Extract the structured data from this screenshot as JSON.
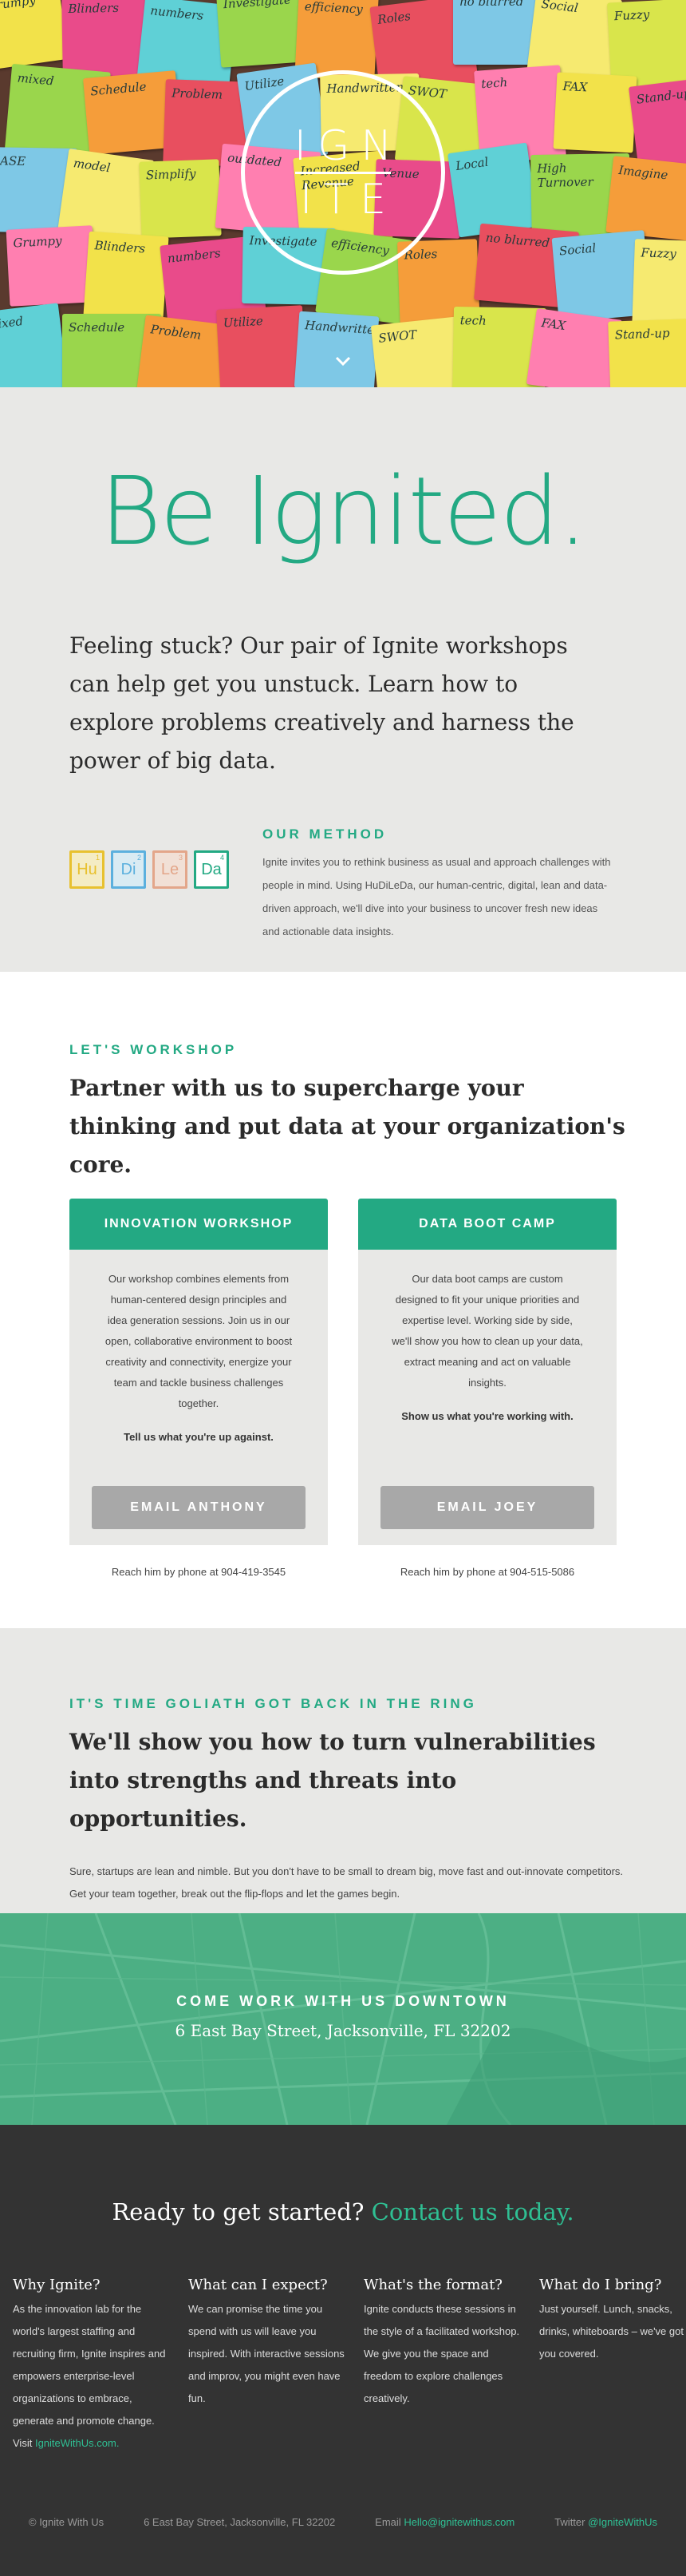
{
  "hero": {
    "logo_top": "IGN",
    "logo_bottom": "ITE",
    "notes": [
      "Grumpy",
      "Blinders",
      "numbers",
      "Investigate",
      "efficiency",
      "Roles",
      "no blurred",
      "Social",
      "Fuzzy",
      "mixed",
      "Schedule",
      "Problem",
      "Utilize",
      "Handwritten",
      "SWOT",
      "tech",
      "FAX",
      "Stand-up",
      "CASE",
      "model",
      "Simplify",
      "outdated",
      "Increased Revenue",
      "Venue",
      "Local",
      "High Turnover",
      "Imagine"
    ]
  },
  "intro": {
    "title": "Be Ignited.",
    "lead": "Feeling stuck? Our pair of Ignite workshops can help get you unstuck. Learn how to explore problems creatively and harness the power of big data.",
    "method_label": "OUR METHOD",
    "method_text": "Ignite invites you to rethink business as usual and approach challenges with people in mind. Using HuDiLeDa, our human-centric, digital, lean and data-driven approach, we'll dive into your business to uncover fresh new ideas and actionable data insights.",
    "elements": [
      {
        "symbol": "Hu",
        "num": "1",
        "color": "#e8c12f"
      },
      {
        "symbol": "Di",
        "num": "2",
        "color": "#5cb0de"
      },
      {
        "symbol": "Le",
        "num": "3",
        "color": "#e3a68a"
      },
      {
        "symbol": "Da",
        "num": "4",
        "color": "#23a983"
      }
    ]
  },
  "workshop": {
    "label": "LET'S WORKSHOP",
    "heading": "Partner with us to supercharge your thinking and put data at your organization's core.",
    "cards": [
      {
        "title": "INNOVATION WORKSHOP",
        "body": "Our workshop combines elements from human-centered design principles and idea generation sessions. Join us in our open, collaborative environment to boost creativity and connectivity, energize your team and tackle business challenges together.",
        "cta": "Tell us what you're up against.",
        "button": "EMAIL ANTHONY",
        "phone": "Reach him by phone at 904-419-3545"
      },
      {
        "title": "DATA BOOT CAMP",
        "body": "Our data boot camps are custom designed to fit your unique priorities and expertise level. Working side by side, we'll show you how to clean up your data, extract meaning and act on valuable insights.",
        "cta": "Show us what you're working with.",
        "button": "EMAIL JOEY",
        "phone": "Reach him by phone at 904-515-5086"
      }
    ]
  },
  "goliath": {
    "label": "IT'S TIME GOLIATH GOT BACK IN THE RING",
    "heading": "We'll show you how to turn vulnerabilities into strengths and threats into opportunities.",
    "body": "Sure, startups are lean and nimble. But you don't have to be small to dream big, move fast and out-innovate competitors. Get your team together, break out the flip-flops and let the games begin."
  },
  "map": {
    "label": "COME WORK WITH US DOWNTOWN",
    "address": "6 East Bay Street, Jacksonville, FL 32202"
  },
  "footer": {
    "ready": "Ready to get started?",
    "contact": "Contact us today.",
    "cols": [
      {
        "title": "Why Ignite?",
        "text": "As the innovation lab for the world's largest staffing and recruiting firm, Ignite inspires and empowers enterprise-level organizations to embrace, generate and promote change. Visit",
        "link": "IgniteWithUs.com."
      },
      {
        "title": "What can I expect?",
        "text": "We can promise the time you spend with us will leave you inspired. With interactive sessions and improv, you might even have fun."
      },
      {
        "title": "What's the format?",
        "text": "Ignite conducts these sessions in the style of a facilitated workshop. We give you the space and freedom to explore challenges creatively."
      },
      {
        "title": "What do I bring?",
        "text": "Just yourself. Lunch, snacks, drinks, whiteboards – we've got you covered."
      }
    ],
    "copyright": "© Ignite With Us",
    "address": "6 East Bay Street, Jacksonville, FL 32202",
    "email_label": "Email",
    "email": "Hello@ignitewithus.com",
    "twitter_label": "Twitter",
    "twitter": "@IgniteWithUs"
  },
  "colors": {
    "accent": "#23a983",
    "map": "#4caf84",
    "footer": "#333333"
  }
}
